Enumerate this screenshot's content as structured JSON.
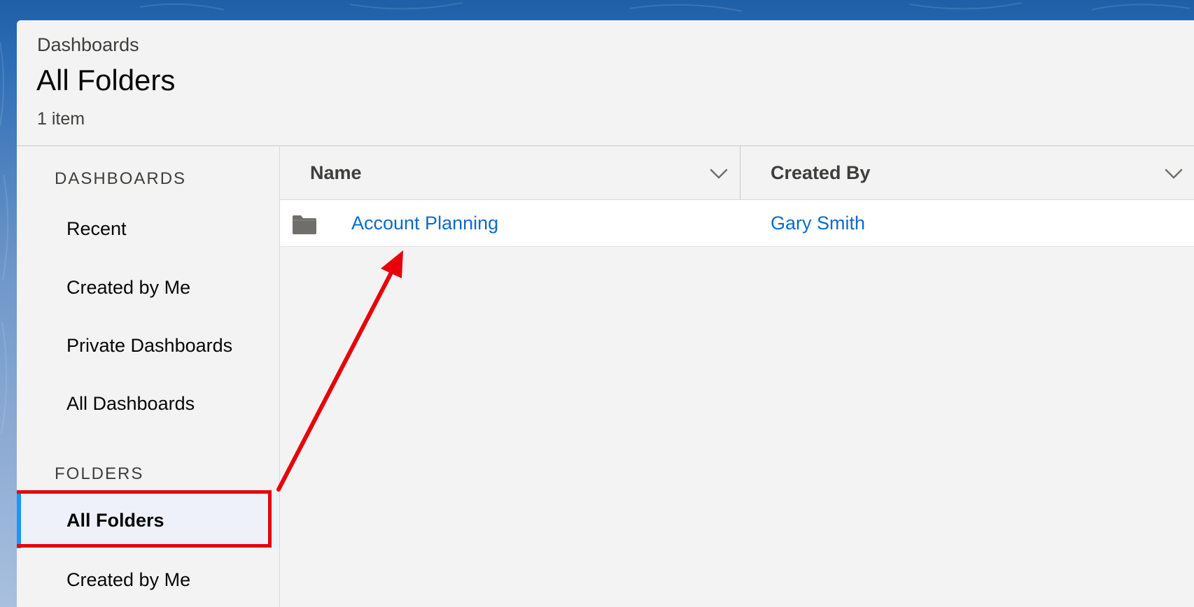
{
  "header": {
    "breadcrumb": "Dashboards",
    "title": "All Folders",
    "item_count": "1 item"
  },
  "sidebar": {
    "dashboards_heading": "DASHBOARDS",
    "dashboards_items": [
      {
        "label": "Recent"
      },
      {
        "label": "Created by Me"
      },
      {
        "label": "Private Dashboards"
      },
      {
        "label": "All Dashboards"
      }
    ],
    "folders_heading": "FOLDERS",
    "folders_items": [
      {
        "label": "All Folders",
        "active": true
      },
      {
        "label": "Created by Me"
      }
    ]
  },
  "table": {
    "columns": [
      "Name",
      "Created By"
    ],
    "rows": [
      {
        "name": "Account Planning",
        "created_by": "Gary Smith",
        "icon": "folder-icon"
      }
    ]
  },
  "colors": {
    "accent": "#1b96ff",
    "link": "#0b6bcb",
    "annotation": "#e8000b",
    "panel_bg": "#f3f3f3",
    "brand_bg": "#1f5fa8"
  },
  "icons": {
    "column_menu": "chevron-down-icon",
    "row_type": "folder-icon"
  }
}
